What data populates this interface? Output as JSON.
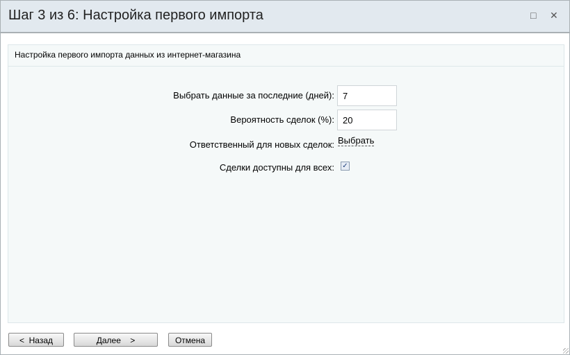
{
  "window": {
    "title": "Шаг 3 из 6: Настройка первого импорта",
    "maximize_icon": "□",
    "close_icon": "✕"
  },
  "panel": {
    "header": "Настройка первого импорта данных из интернет-магазина"
  },
  "form": {
    "days_label": "Выбрать данные за последние (дней):",
    "days_value": "7",
    "prob_label": "Вероятность сделок (%):",
    "prob_value": "20",
    "resp_label": "Ответственный для новых сделок:",
    "resp_link": "Выбрать",
    "public_label": "Сделки доступны для всех:",
    "public_checked": true
  },
  "buttons": {
    "back": "<  Назад",
    "next": "Далее    >",
    "cancel": "Отмена"
  }
}
